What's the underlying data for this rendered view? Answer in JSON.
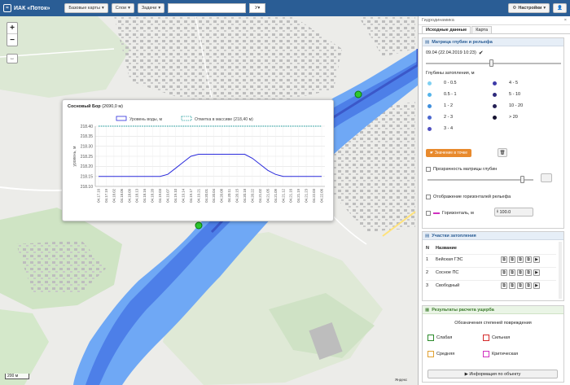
{
  "app": {
    "title": "ИАК «Поток»",
    "menus": [
      "Базовые карты",
      "Слои",
      "Задачи"
    ],
    "search_select": "У",
    "settings_label": "Настройки"
  },
  "popup": {
    "title_bold": "Сосновый Бор",
    "title_rest": "(2690,0 м)",
    "legend_water": "Уровень воды, м",
    "legend_mark": "Отметка в массиве (218,40 м)",
    "colors": {
      "water": "#2b2bdc",
      "mark": "#1b9a9a"
    }
  },
  "chart_data": {
    "type": "line",
    "title": "Сосновый Бор (2690,0 м)",
    "ylabel": "уровень, м",
    "ylim": [
      218.1,
      218.4
    ],
    "yticks": [
      "218.40",
      "218.35",
      "218.30",
      "218.25",
      "218.20",
      "218.15",
      "218.10"
    ],
    "x": [
      "04.17.16",
      "04.17.19",
      "04.18.02",
      "04.18.06",
      "04.18.09",
      "04.18.13",
      "04.18.16",
      "04.18.20",
      "04.19.03",
      "04.19.07",
      "04.19.10",
      "04.19.14",
      "04.19.17",
      "04.19.21",
      "04.20.01",
      "04.20.04",
      "04.20.08",
      "04.20.11",
      "04.20.15",
      "04.20.18",
      "04.20.22",
      "04.21.02",
      "04.21.05",
      "04.21.09",
      "04.21.12",
      "04.21.16",
      "04.21.19",
      "04.21.23",
      "04.22.03",
      "04.22.06"
    ],
    "series": [
      {
        "name": "Уровень воды, м",
        "values": [
          218.15,
          218.15,
          218.15,
          218.15,
          218.15,
          218.15,
          218.15,
          218.15,
          218.15,
          218.16,
          218.19,
          218.22,
          218.25,
          218.26,
          218.26,
          218.26,
          218.26,
          218.26,
          218.26,
          218.26,
          218.24,
          218.21,
          218.18,
          218.16,
          218.15,
          218.15,
          218.15,
          218.15,
          218.15,
          218.15
        ]
      },
      {
        "name": "Отметка в массиве (218,40 м)",
        "values": [
          218.4,
          218.4,
          218.4,
          218.4,
          218.4,
          218.4,
          218.4,
          218.4,
          218.4,
          218.4,
          218.4,
          218.4,
          218.4,
          218.4,
          218.4,
          218.4,
          218.4,
          218.4,
          218.4,
          218.4,
          218.4,
          218.4,
          218.4,
          218.4,
          218.4,
          218.4,
          218.4,
          218.4,
          218.4,
          218.4
        ]
      }
    ],
    "grid": true
  },
  "panel": {
    "head": "Гидродинамика",
    "tabs": [
      "Исходные данные",
      "Карта"
    ],
    "matrix_title": "Матрица глубин и рельефа",
    "date_value": "09.04 (22.04.2019 10:23)",
    "depth_label": "Глубины затопления, м",
    "depth_legend": [
      {
        "label": "0 - 0.5",
        "color": "#7fd0f2"
      },
      {
        "label": "4 - 5",
        "color": "#3d3aa8"
      },
      {
        "label": "0.5 - 1",
        "color": "#54b4ea"
      },
      {
        "label": "5 - 10",
        "color": "#2e2a7d"
      },
      {
        "label": "1 - 2",
        "color": "#3f8fdc"
      },
      {
        "label": "10 - 20",
        "color": "#252055"
      },
      {
        "label": "2 - 3",
        "color": "#4a67cf"
      },
      {
        "label": "> 20",
        "color": "#151230"
      },
      {
        "label": "3 - 4",
        "color": "#5050c0"
      }
    ],
    "point_btn": "Значение в точке",
    "opacity_label": "Прозрачность матрицы глубин",
    "contour_label": "Отображение горизонталей рельефа",
    "horiz_label": "Горизонталь, м",
    "horiz_value": "100.0",
    "sites_title": "Участки затопления",
    "sites_col_n": "N",
    "sites_col_name": "Название",
    "sites": [
      {
        "n": "1",
        "name": "Бейская ГЭС"
      },
      {
        "n": "2",
        "name": "Сосное ПС"
      },
      {
        "n": "3",
        "name": "Свободный"
      }
    ],
    "damage_title": "Результаты расчета ущерба",
    "damage_sub": "Обозначения степеней повреждения",
    "damage_legend": [
      {
        "label": "Слабая",
        "color": "#2a8a2a"
      },
      {
        "label": "Сильная",
        "color": "#d42a2a"
      },
      {
        "label": "Средняя",
        "color": "#e0a030"
      },
      {
        "label": "Критическая",
        "color": "#d030c0"
      }
    ],
    "info_btn": "Информация по объекту"
  },
  "map": {
    "scale": "200 м",
    "attribution": "Яндекс"
  }
}
